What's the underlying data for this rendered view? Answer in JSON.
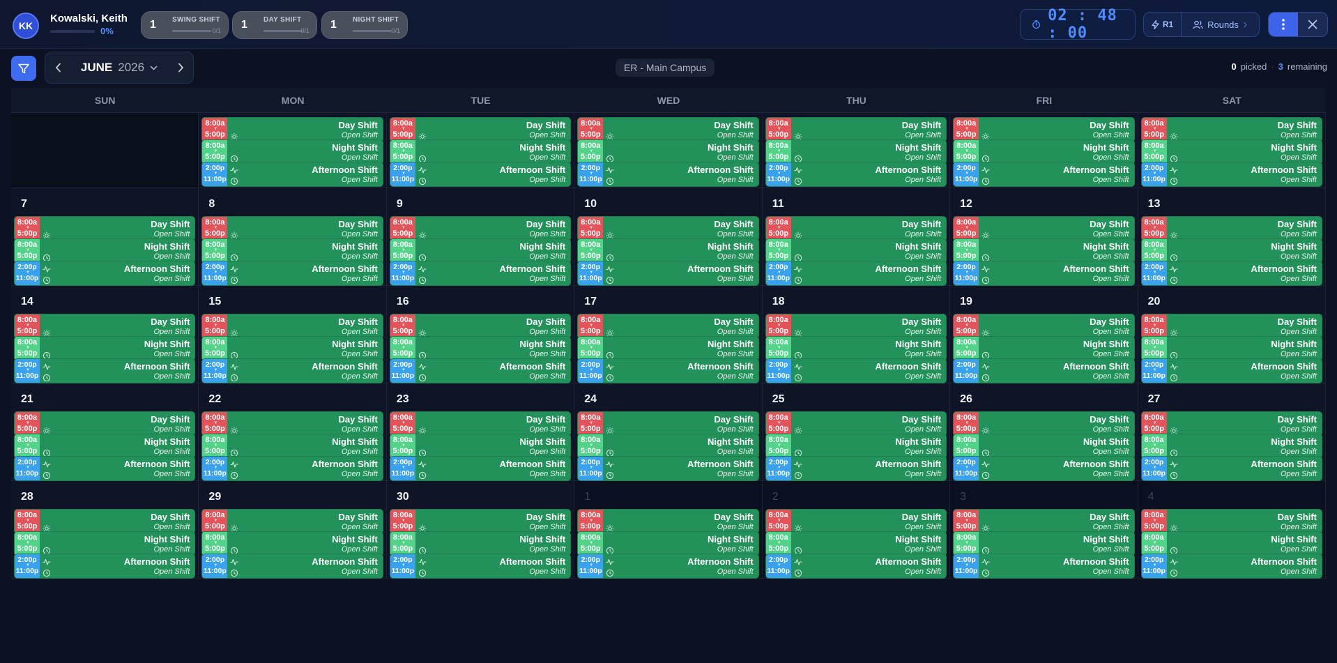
{
  "user": {
    "initials": "KK",
    "name": "Kowalski, Keith",
    "progress": "0%"
  },
  "shift_chips": [
    {
      "count": "1",
      "label": "SWING SHIFT",
      "fraction": "0/1"
    },
    {
      "count": "1",
      "label": "DAY SHIFT",
      "fraction": "0/1"
    },
    {
      "count": "1",
      "label": "NIGHT SHIFT",
      "fraction": "0/1"
    }
  ],
  "timer": {
    "value": "02 : 48 : 00"
  },
  "round_badge": "R1",
  "rounds_label": "Rounds",
  "month": {
    "name": "JUNE",
    "year": "2026"
  },
  "location": "ER - Main Campus",
  "pick_status": {
    "picked": "0",
    "picked_label": "picked",
    "remaining": "3",
    "remaining_label": "remaining"
  },
  "weekdays": [
    "SUN",
    "MON",
    "TUE",
    "WED",
    "THU",
    "FRI",
    "SAT"
  ],
  "shift_templates": {
    "day": {
      "start": "8:00a",
      "end": "5:00p",
      "name": "Day Shift",
      "status": "Open Shift"
    },
    "night": {
      "start": "8:00a",
      "end": "5:00p",
      "name": "Night Shift",
      "status": "Open Shift"
    },
    "afternoon": {
      "start": "2:00p",
      "end": "11:00p",
      "name": "Afternoon Shift",
      "status": "Open Shift"
    }
  },
  "weeks": [
    [
      "",
      "",
      "",
      "",
      "",
      "",
      ""
    ],
    [
      "7",
      "8",
      "9",
      "10",
      "11",
      "12",
      "13"
    ],
    [
      "14",
      "15",
      "16",
      "17",
      "18",
      "19",
      "20"
    ],
    [
      "21",
      "22",
      "23",
      "24",
      "25",
      "26",
      "27"
    ],
    [
      "28",
      "29",
      "30",
      "1",
      "2",
      "3",
      "4"
    ]
  ],
  "colors": {
    "day": "#e2545a",
    "night": "#53d38a",
    "afternoon": "#3aa1ee",
    "shift_bg": "#23915a",
    "accent": "#4f8cff"
  }
}
